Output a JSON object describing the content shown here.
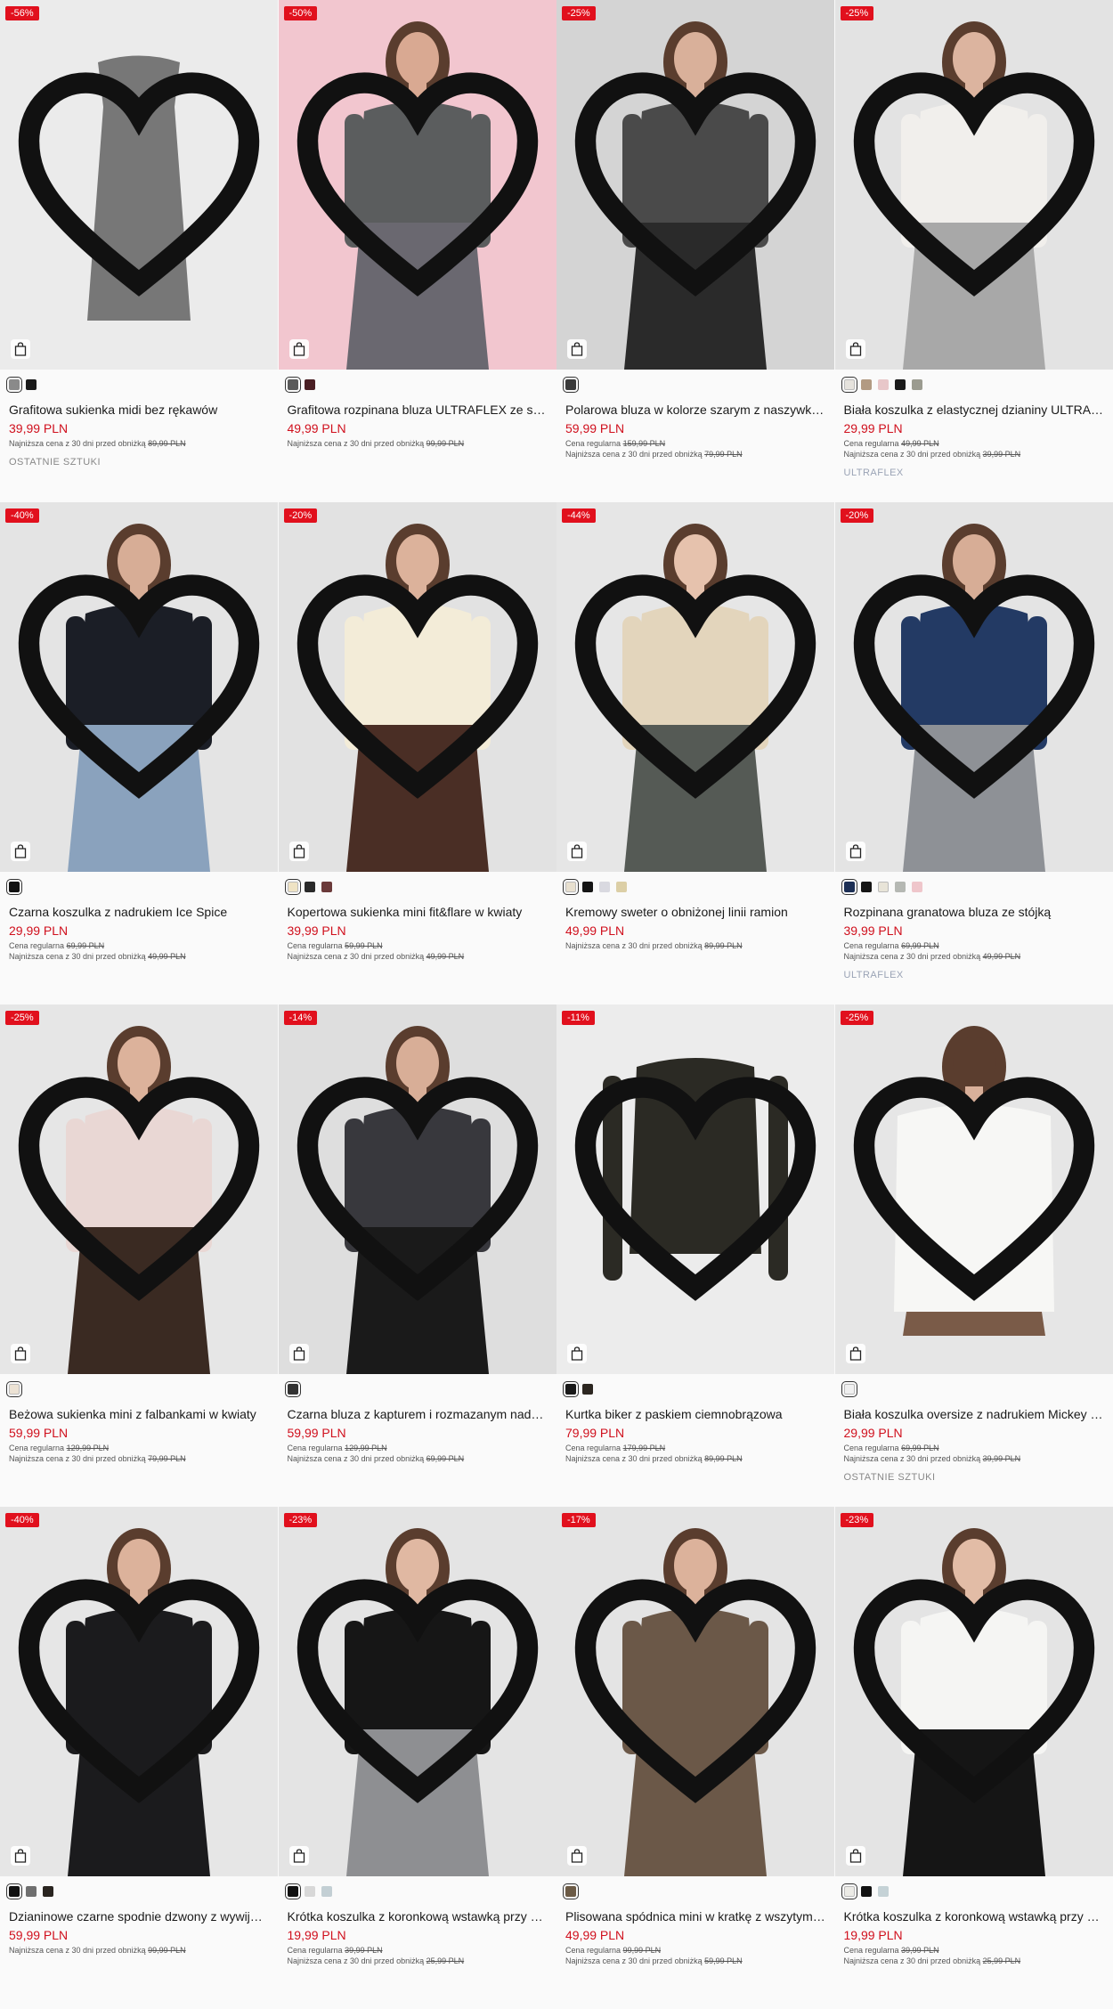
{
  "products": [
    {
      "badge": "-56%",
      "name": "Grafitowa sukienka midi bez rękawów",
      "price": "39,99 PLN",
      "regular_label": "",
      "regular_value": "",
      "lowest_label": "Najniższa cena z 30 dni przed obniżką",
      "lowest_value": "89,99 PLN",
      "tag": "OSTATNIE SZTUKI",
      "swatches": [
        "#8a8a8a",
        "#1a1a1a"
      ],
      "image": {
        "bg": "#ebebeb",
        "garment": "#777777",
        "skin": "#ebebeb",
        "bottom": "#777777",
        "type": "dress"
      }
    },
    {
      "badge": "-50%",
      "name": "Grafitowa rozpinana bluza ULTRAFLEX ze stójką",
      "price": "49,99 PLN",
      "regular_label": "",
      "regular_value": "",
      "lowest_label": "Najniższa cena z 30 dni przed obniżką",
      "lowest_value": "99,99 PLN",
      "tag": "",
      "swatches": [
        "#5a5a5a",
        "#4a1f24"
      ],
      "image": {
        "bg": "#f2c6cf",
        "garment": "#5b5d5e",
        "skin": "#d9a992",
        "bottom": "#6a6870",
        "type": "model"
      }
    },
    {
      "badge": "-25%",
      "name": "Polarowa bluza w kolorze szarym z naszywką Hello Kitty",
      "price": "59,99 PLN",
      "regular_label": "Cena regularna",
      "regular_value": "159,99 PLN",
      "lowest_label": "Najniższa cena z 30 dni przed obniżką",
      "lowest_value": "79,99 PLN",
      "tag": "",
      "swatches": [
        "#3a3a3a"
      ],
      "image": {
        "bg": "#d4d4d4",
        "garment": "#4a4a4a",
        "skin": "#d9b09a",
        "bottom": "#2a2a2a",
        "type": "model"
      }
    },
    {
      "badge": "-25%",
      "name": "Biała koszulka z elastycznej dzianiny ULTRAFLEX",
      "price": "29,99 PLN",
      "regular_label": "Cena regularna",
      "regular_value": "49,99 PLN",
      "lowest_label": "Najniższa cena z 30 dni przed obniżką",
      "lowest_value": "39,99 PLN",
      "tag": "ULTRAFLEX",
      "swatches": [
        "#e6e3dd",
        "#b29a82",
        "#e8c7c9",
        "#1a1a1a",
        "#9b9b90"
      ],
      "image": {
        "bg": "#e3e3e3",
        "garment": "#f1efec",
        "skin": "#dcb49f",
        "bottom": "#a8a8a8",
        "type": "model"
      }
    },
    {
      "badge": "-40%",
      "name": "Czarna koszulka z nadrukiem Ice Spice",
      "price": "29,99 PLN",
      "regular_label": "Cena regularna",
      "regular_value": "69,99 PLN",
      "lowest_label": "Najniższa cena z 30 dni przed obniżką",
      "lowest_value": "49,99 PLN",
      "tag": "",
      "swatches": [
        "#111111"
      ],
      "image": {
        "bg": "#e4e4e4",
        "garment": "#1b1e26",
        "skin": "#d7ad96",
        "bottom": "#8aa2bd",
        "type": "model"
      }
    },
    {
      "badge": "-20%",
      "name": "Kopertowa sukienka mini fit&flare w kwiaty",
      "price": "39,99 PLN",
      "regular_label": "Cena regularna",
      "regular_value": "59,99 PLN",
      "lowest_label": "Najniższa cena z 30 dni przed obniżką",
      "lowest_value": "49,99 PLN",
      "tag": "",
      "swatches": [
        "#efe3c4",
        "#2a2a2a",
        "#6b3a3a"
      ],
      "image": {
        "bg": "#e2e2e2",
        "garment": "#f3ecd8",
        "skin": "#dcb29b",
        "bottom": "#4a2e25",
        "type": "model"
      }
    },
    {
      "badge": "-44%",
      "name": "Kremowy sweter o obniżonej linii ramion",
      "price": "49,99 PLN",
      "regular_label": "",
      "regular_value": "",
      "lowest_label": "Najniższa cena z 30 dni przed obniżką",
      "lowest_value": "89,99 PLN",
      "tag": "",
      "swatches": [
        "#e8e0cf",
        "#151515",
        "#d9d9e0",
        "#dccfa6"
      ],
      "image": {
        "bg": "#e6e6e6",
        "garment": "#e3d5bc",
        "skin": "#e6c2ad",
        "bottom": "#555a55",
        "type": "model"
      }
    },
    {
      "badge": "-20%",
      "name": "Rozpinana granatowa bluza ze stójką",
      "price": "39,99 PLN",
      "regular_label": "Cena regularna",
      "regular_value": "69,99 PLN",
      "lowest_label": "Najniższa cena z 30 dni przed obniżką",
      "lowest_value": "49,99 PLN",
      "tag": "ULTRAFLEX",
      "swatches": [
        "#1c2f55",
        "#151515",
        "#e8e4d8",
        "#b5b8b3",
        "#efc6cb"
      ],
      "image": {
        "bg": "#e4e4e4",
        "garment": "#233a64",
        "skin": "#d7ad96",
        "bottom": "#8e9196",
        "type": "model"
      }
    },
    {
      "badge": "-25%",
      "name": "Beżowa sukienka mini z falbankami w kwiaty",
      "price": "59,99 PLN",
      "regular_label": "Cena regularna",
      "regular_value": "129,99 PLN",
      "lowest_label": "Najniższa cena z 30 dni przed obniżką",
      "lowest_value": "79,99 PLN",
      "tag": "",
      "swatches": [
        "#ece2d4"
      ],
      "image": {
        "bg": "#e6e6e6",
        "garment": "#e9d7d4",
        "skin": "#dcb29b",
        "bottom": "#3a2a22",
        "type": "model"
      }
    },
    {
      "badge": "-14%",
      "name": "Czarna bluza z kapturem i rozmazanym nadrukiem",
      "price": "59,99 PLN",
      "regular_label": "Cena regularna",
      "regular_value": "129,99 PLN",
      "lowest_label": "Najniższa cena z 30 dni przed obniżką",
      "lowest_value": "69,99 PLN",
      "tag": "",
      "swatches": [
        "#333333"
      ],
      "image": {
        "bg": "#dedede",
        "garment": "#38383d",
        "skin": "#d8ae97",
        "bottom": "#1a1a1a",
        "type": "model"
      }
    },
    {
      "badge": "-11%",
      "name": "Kurtka biker z paskiem ciemnobrązowa",
      "price": "79,99 PLN",
      "regular_label": "Cena regularna",
      "regular_value": "179,99 PLN",
      "lowest_label": "Najniższa cena z 30 dni przed obniżką",
      "lowest_value": "89,99 PLN",
      "tag": "",
      "swatches": [
        "#1a1a1a",
        "#2c2620"
      ],
      "image": {
        "bg": "#ececec",
        "garment": "#2b2a24",
        "skin": "#ececec",
        "bottom": "#2b2a24",
        "type": "jacket"
      }
    },
    {
      "badge": "-25%",
      "name": "Biała koszulka oversize z nadrukiem Mickey Mouse",
      "price": "29,99 PLN",
      "regular_label": "Cena regularna",
      "regular_value": "69,99 PLN",
      "lowest_label": "Najniższa cena z 30 dni przed obniżką",
      "lowest_value": "39,99 PLN",
      "tag": "OSTATNIE SZTUKI",
      "swatches": [
        "#f0f0f0"
      ],
      "image": {
        "bg": "#e6e6e6",
        "garment": "#f7f7f5",
        "skin": "#d9b09a",
        "bottom": "#7a5b48",
        "type": "back"
      }
    },
    {
      "badge": "-40%",
      "name": "Dzianinowe czarne spodnie dzwony z wywijanym pasem",
      "price": "59,99 PLN",
      "regular_label": "",
      "regular_value": "",
      "lowest_label": "Najniższa cena z 30 dni przed obniżką",
      "lowest_value": "99,99 PLN",
      "tag": "",
      "swatches": [
        "#111111",
        "#6f6f6f",
        "#2a2520"
      ],
      "image": {
        "bg": "#e6e6e6",
        "garment": "#1b1b1d",
        "skin": "#dcb29b",
        "bottom": "#1b1b1d",
        "type": "model"
      }
    },
    {
      "badge": "-23%",
      "name": "Krótka koszulka z koronkową wstawką przy dekolcie",
      "price": "19,99 PLN",
      "regular_label": "Cena regularna",
      "regular_value": "39,99 PLN",
      "lowest_label": "Najniższa cena z 30 dni przed obniżką",
      "lowest_value": "25,99 PLN",
      "tag": "",
      "swatches": [
        "#111111",
        "#d8d8d8",
        "#c3cfd4"
      ],
      "image": {
        "bg": "#e4e4e4",
        "garment": "#161616",
        "skin": "#e0b8a2",
        "bottom": "#8e8f92",
        "type": "model"
      }
    },
    {
      "badge": "-17%",
      "name": "Plisowana spódnica mini w kratkę z wszytymi szortami",
      "price": "49,99 PLN",
      "regular_label": "Cena regularna",
      "regular_value": "99,99 PLN",
      "lowest_label": "Najniższa cena z 30 dni przed obniżką",
      "lowest_value": "59,99 PLN",
      "tag": "",
      "swatches": [
        "#6b5a45"
      ],
      "image": {
        "bg": "#e4e4e4",
        "garment": "#6b5848",
        "skin": "#dcb29b",
        "bottom": "#6b5848",
        "type": "model"
      }
    },
    {
      "badge": "-23%",
      "name": "Krótka koszulka z koronkową wstawką przy dekolcie",
      "price": "19,99 PLN",
      "regular_label": "Cena regularna",
      "regular_value": "39,99 PLN",
      "lowest_label": "Najniższa cena z 30 dni przed obniżką",
      "lowest_value": "25,99 PLN",
      "tag": "",
      "swatches": [
        "#ecebe6",
        "#111111",
        "#c5d2d6"
      ],
      "image": {
        "bg": "#e4e4e4",
        "garment": "#f5f5f3",
        "skin": "#e2bca6",
        "bottom": "#151515",
        "type": "model"
      }
    }
  ]
}
